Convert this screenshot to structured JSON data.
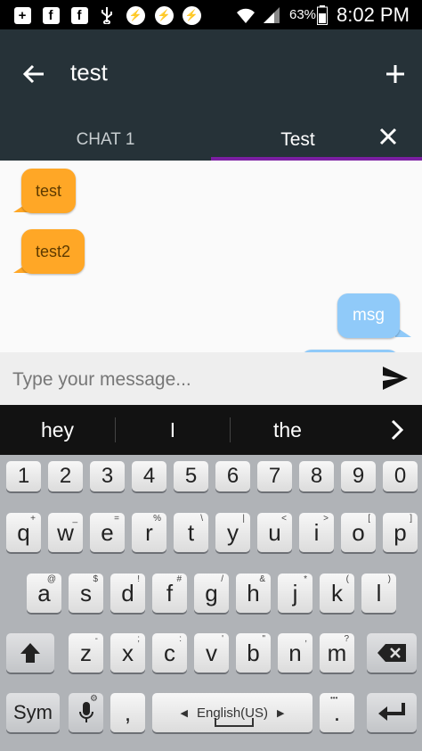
{
  "status_bar": {
    "icons": [
      "add-box-icon",
      "facebook-icon",
      "facebook-icon",
      "usb-icon",
      "messenger-icon",
      "messenger-icon",
      "messenger-icon",
      "wifi-icon",
      "signal-icon"
    ],
    "battery_percent": "63%",
    "time": "8:02 PM"
  },
  "app_bar": {
    "title": "test"
  },
  "tabs": [
    {
      "label": "CHAT 1",
      "active": false
    },
    {
      "label": "Test",
      "active": true
    }
  ],
  "messages": [
    {
      "text": "test",
      "direction": "incoming"
    },
    {
      "text": "test2",
      "direction": "incoming"
    },
    {
      "text": "msg",
      "direction": "outgoing"
    }
  ],
  "composer": {
    "placeholder": "Type your message..."
  },
  "suggestions": [
    "hey",
    "I",
    "the"
  ],
  "keyboard": {
    "number_row": [
      "1",
      "2",
      "3",
      "4",
      "5",
      "6",
      "7",
      "8",
      "9",
      "0"
    ],
    "row1": [
      {
        "key": "q",
        "sub": "+"
      },
      {
        "key": "w",
        "sub": "_"
      },
      {
        "key": "e",
        "sub": "="
      },
      {
        "key": "r",
        "sub": "%"
      },
      {
        "key": "t",
        "sub": "\\"
      },
      {
        "key": "y",
        "sub": "|"
      },
      {
        "key": "u",
        "sub": "<"
      },
      {
        "key": "i",
        "sub": ">"
      },
      {
        "key": "o",
        "sub": "["
      },
      {
        "key": "p",
        "sub": "]"
      }
    ],
    "row2": [
      {
        "key": "a",
        "sub": "@"
      },
      {
        "key": "s",
        "sub": "$"
      },
      {
        "key": "d",
        "sub": "!"
      },
      {
        "key": "f",
        "sub": "#"
      },
      {
        "key": "g",
        "sub": "/"
      },
      {
        "key": "h",
        "sub": "&"
      },
      {
        "key": "j",
        "sub": "*"
      },
      {
        "key": "k",
        "sub": "("
      },
      {
        "key": "l",
        "sub": ")"
      }
    ],
    "row3": [
      {
        "key": "z",
        "sub": "-"
      },
      {
        "key": "x",
        "sub": ";"
      },
      {
        "key": "c",
        "sub": ":"
      },
      {
        "key": "v",
        "sub": "'"
      },
      {
        "key": "b",
        "sub": "\""
      },
      {
        "key": "n",
        "sub": ","
      },
      {
        "key": "m",
        "sub": "?"
      }
    ],
    "sym_label": "Sym",
    "comma_label": ",",
    "space_label": "English(US)",
    "period_label": ".",
    "period_sub": "•••"
  }
}
